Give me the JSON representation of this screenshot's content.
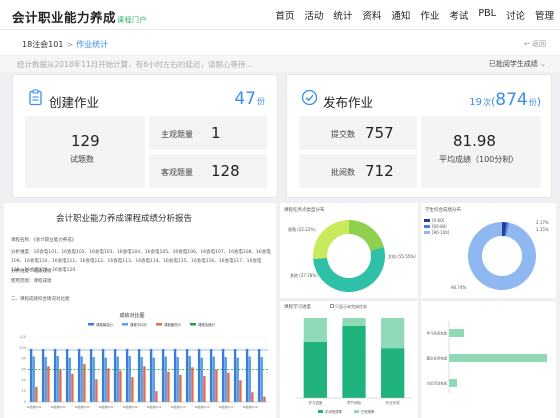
{
  "header": {
    "logo": "会计职业能力养成",
    "logo_sub": "课程门户",
    "nav": [
      "首页",
      "活动",
      "统计",
      "资料",
      "通知",
      "作业",
      "考试",
      "PBL",
      "讨论",
      "管理"
    ]
  },
  "breadcrumb": {
    "course": "18注会101",
    "sep": ">",
    "current": "作业统计",
    "back": "返回"
  },
  "notice": {
    "text": "统计数据从2018年11月开始计算，有6小时左右的延迟，请耐心等待...",
    "selector": "已批阅学生成绩"
  },
  "create": {
    "title": "创建作业",
    "count": "47",
    "unit": "份",
    "tiles": {
      "total_num": "129",
      "total_label": "试题数",
      "subj_label": "主观题量",
      "subj_num": "1",
      "obj_label": "客观题量",
      "obj_num": "128"
    }
  },
  "publish": {
    "title": "发布作业",
    "times": "19",
    "times_unit": "次",
    "count": "874",
    "unit": "份",
    "tiles": {
      "submit_label": "提交数",
      "submit_num": "757",
      "review_label": "批阅数",
      "review_num": "712",
      "avg_num": "81.98",
      "avg_label": "平均成绩（100分制）"
    }
  },
  "report": {
    "title": "会计职业能力养成课程成绩分析报告",
    "lines": [
      "课程名称：《会计职业能力养成》",
      "分析维度：16会电101、16会电102、16会电103、16会电104、16会电105、16会电106、16会电107、16会电108、16会电109、16会电110、16会电111、16会电112、16会电113、16会电114、16会电115、16会电116、16会电117、16会电118、16会电119、16会电120",
      "分析维度：班级成绩",
      "使用范围：课程成绩"
    ],
    "section": "二、课程成绩综合情况对比图",
    "bar_chart": {
      "title": "成绩对比图",
      "legend": [
        "课程最高分",
        "课程平均分",
        "课程最低分",
        "课程及格分"
      ]
    }
  },
  "donut1": {
    "title": "课程任务点类型分布",
    "labels": [
      "视频 (22.22%)",
      "文档 (55.55%)",
      "其他 (27.78%)"
    ]
  },
  "donut2": {
    "title": "学生综合成绩分布",
    "legend": [
      "[0-60)",
      "[60-80)",
      "[80-100]"
    ],
    "labels": [
      "2.17%",
      "1.15%",
      "96.74%"
    ]
  },
  "progress": {
    "title": "课程学习进度",
    "option": "只显示未完成任务",
    "categories": [
      "学习进度",
      "章节测验",
      "作业完成"
    ],
    "legend": [
      "平均完成率",
      "已完成率"
    ]
  },
  "hbar": {
    "labels": [
      "学习任务完成",
      "图文任务完成",
      "讨论活动完成"
    ]
  },
  "chart_data": [
    {
      "type": "bar",
      "title": "成绩对比图",
      "legend": [
        "课程最高分",
        "课程平均分",
        "课程最低分",
        "课程及格分"
      ],
      "ylim": [
        0,
        120
      ],
      "series": [
        {
          "name": "课程最高分",
          "values": [
            98,
            98,
            98,
            98,
            98,
            98,
            98,
            98,
            98,
            98,
            98,
            98,
            98,
            98,
            98,
            98,
            98,
            98,
            98,
            98
          ]
        },
        {
          "name": "课程平均分",
          "values": [
            84,
            83,
            85,
            82,
            84,
            83,
            82,
            84,
            85,
            83,
            82,
            84,
            83,
            85,
            82,
            84,
            83,
            82,
            84,
            83
          ]
        },
        {
          "name": "课程最低分",
          "values": [
            28,
            66,
            60,
            52,
            70,
            42,
            62,
            58,
            46,
            66,
            20,
            56,
            50,
            64,
            48,
            60,
            54,
            40,
            18,
            10
          ]
        }
      ],
      "pass_line": 60,
      "max_line": 96,
      "categories": [
        "16会电101",
        "16会电102",
        "16会电103",
        "16会电104",
        "16会电105",
        "16会电106",
        "16会电107",
        "16会电108",
        "16会电109",
        "16会电110",
        "16会电111",
        "16会电112",
        "16会电113",
        "16会电114",
        "16会电115",
        "16会电116",
        "16会电117",
        "16会电118",
        "16会电119",
        "16会电120"
      ]
    },
    {
      "type": "pie",
      "title": "课程任务点类型分布",
      "categories": [
        "视频",
        "文档",
        "其他"
      ],
      "values": [
        22.22,
        55.55,
        27.78
      ]
    },
    {
      "type": "pie",
      "title": "学生综合成绩分布",
      "categories": [
        "[0-60)",
        "[60-80)",
        "[80-100]"
      ],
      "values": [
        2.17,
        1.15,
        96.74
      ]
    },
    {
      "type": "bar",
      "title": "课程学习进度",
      "categories": [
        "学习进度",
        "章节测验",
        "作业完成"
      ],
      "series": [
        {
          "name": "平均完成率",
          "values": [
            70,
            90,
            62
          ]
        },
        {
          "name": "已完成率",
          "values": [
            100,
            100,
            100
          ]
        }
      ],
      "ylim": [
        0,
        100
      ]
    },
    {
      "type": "bar",
      "title": "",
      "categories": [
        "学习任务完成",
        "图文任务完成",
        "讨论活动完成"
      ],
      "values": [
        15,
        98,
        8
      ],
      "ylim": [
        0,
        100
      ]
    }
  ]
}
